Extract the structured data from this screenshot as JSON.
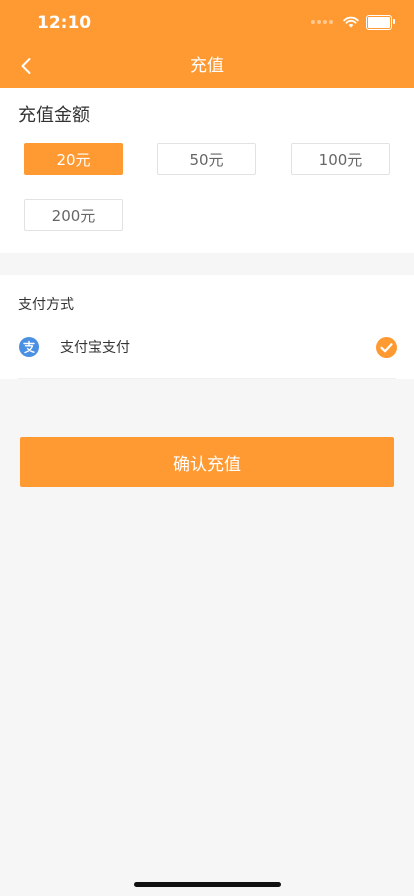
{
  "status_bar": {
    "time": "12:10"
  },
  "nav": {
    "title": "充值",
    "back_icon": "chevron-left-icon"
  },
  "amount_section": {
    "title": "充值金额",
    "options": [
      {
        "label": "20元",
        "selected": true
      },
      {
        "label": "50元",
        "selected": false
      },
      {
        "label": "100元",
        "selected": false
      },
      {
        "label": "200元",
        "selected": false
      }
    ]
  },
  "payment_section": {
    "title": "支付方式",
    "methods": [
      {
        "label": "支付宝支付",
        "icon": "alipay-icon",
        "checked": true
      }
    ]
  },
  "confirm_button": {
    "label": "确认充值"
  },
  "colors": {
    "accent": "#FF9A33",
    "alipay_blue": "#4A90E2"
  }
}
